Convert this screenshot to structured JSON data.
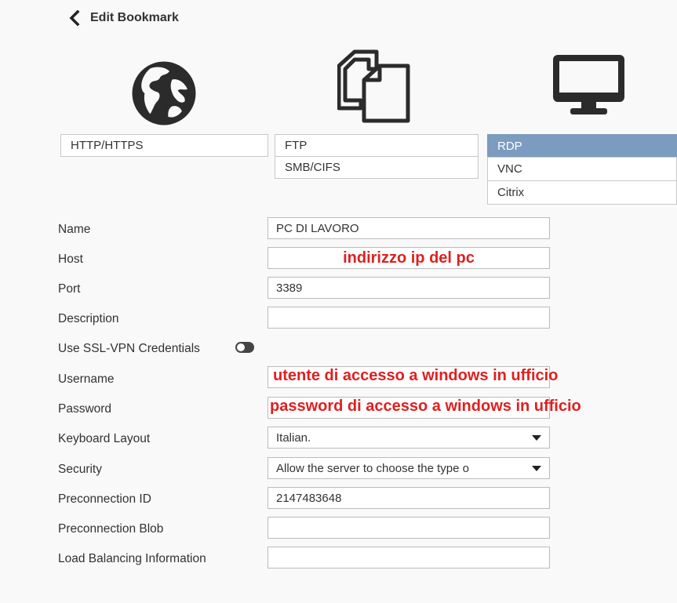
{
  "header": {
    "title": "Edit Bookmark"
  },
  "protocols": {
    "http": "HTTP/HTTPS",
    "ftp": "FTP",
    "smb": "SMB/CIFS",
    "rdp": "RDP",
    "vnc": "VNC",
    "citrix": "Citrix",
    "selected": "RDP"
  },
  "icons": {
    "web": "globe-icon",
    "file": "files-icon",
    "desktop": "monitor-icon"
  },
  "form": {
    "name_label": "Name",
    "name_value": "PC DI LAVORO",
    "host_label": "Host",
    "host_value": "",
    "host_annotation": "indirizzo ip del pc",
    "port_label": "Port",
    "port_value": "3389",
    "description_label": "Description",
    "description_value": "",
    "ssl_label": "Use SSL-VPN Credentials",
    "ssl_enabled": false,
    "username_label": "Username",
    "username_annotation": "utente di accesso a windows in ufficio",
    "password_label": "Password",
    "password_annotation": "password di accesso a windows in ufficio",
    "keyboard_label": "Keyboard Layout",
    "keyboard_value": "Italian.",
    "security_label": "Security",
    "security_value": "Allow the server to choose the type o",
    "preconnection_id_label": "Preconnection ID",
    "preconnection_id_value": "2147483648",
    "preconnection_blob_label": "Preconnection Blob",
    "preconnection_blob_value": "",
    "load_balancing_label": "Load Balancing Information",
    "load_balancing_value": ""
  },
  "colors": {
    "selected_bg": "#7c9cbf",
    "annotation": "#e01f1f"
  }
}
